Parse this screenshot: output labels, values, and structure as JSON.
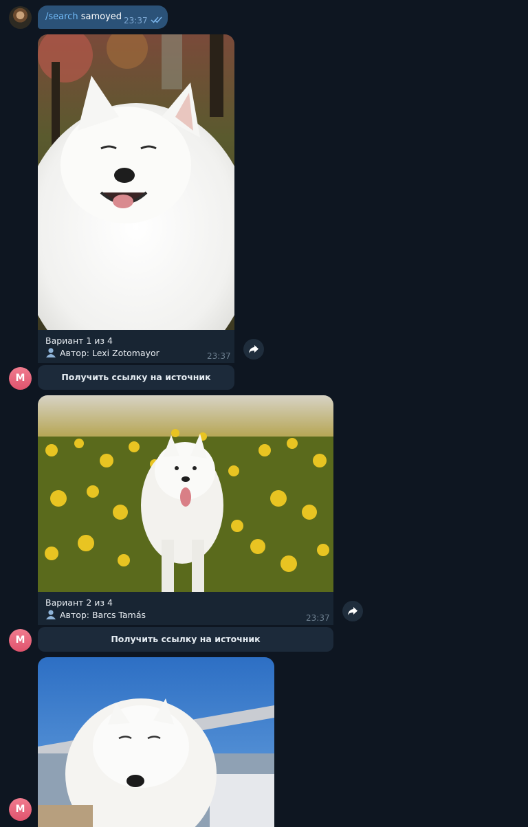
{
  "user_message": {
    "command": "/search",
    "query": " samoyed",
    "time": "23:37"
  },
  "results": [
    {
      "variant": "Вариант 1 из 4",
      "author_prefix": "Автор: ",
      "author": "Lexi Zotomayor",
      "time": "23:37",
      "button_label": "Получить ссылку на источник",
      "photo_icon": "samoyed-photo-autumn"
    },
    {
      "variant": "Вариант 2 из 4",
      "author_prefix": "Автор: ",
      "author": "Barcs Tamás",
      "time": "23:37",
      "button_label": "Получить ссылку на источник",
      "photo_icon": "samoyed-photo-flower-field"
    },
    {
      "photo_icon": "samoyed-photo-sky"
    }
  ],
  "bot_avatar_letter": "M",
  "colors": {
    "background": "#0e1621",
    "own_bubble": "#2b5278",
    "caption_bg": "#182533",
    "button_bg": "#1c2a3a",
    "link": "#71baf7",
    "bot_avatar": "#e0536d"
  }
}
